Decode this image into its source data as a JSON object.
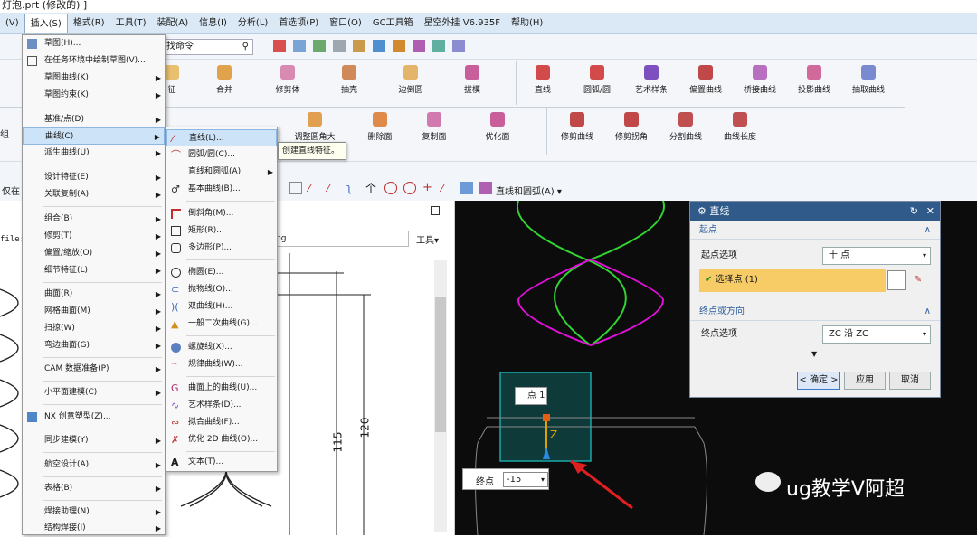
{
  "window": {
    "title": "灯泡.prt  (修改的)  ]"
  },
  "menubar": [
    "(V)",
    "插入(S)",
    "格式(R)",
    "工具(T)",
    "装配(A)",
    "信息(I)",
    "分析(L)",
    "首选项(P)",
    "窗口(O)",
    "GC工具箱",
    "星空外挂 V6.935F",
    "帮助(H)"
  ],
  "toolbar": {
    "search_placeholder": "找命令",
    "line_arc_label": "直线和圆弧(A) ▾"
  },
  "ribbon": {
    "row1": [
      "征",
      "合并",
      "修剪体",
      "抽壳",
      "边倒圆",
      "拔模",
      "直线",
      "圆弧/圆",
      "艺术样条",
      "偏置曲线",
      "桥接曲线",
      "投影曲线",
      "抽取曲线"
    ],
    "row2": [
      "调整圆角大",
      "删除面",
      "复制面",
      "优化面",
      "修剪曲线",
      "修剪拐角",
      "分割曲线",
      "曲线长度"
    ],
    "left_stub": "组"
  },
  "insert_menu": [
    "草图(H)...",
    "在任务环境中绘制草图(V)...",
    "草图曲线(K)",
    "草图约束(K)",
    "基准/点(D)",
    "曲线(C)",
    "派生曲线(U)",
    "设计特征(E)",
    "关联复制(A)",
    "组合(B)",
    "修剪(T)",
    "偏置/缩放(O)",
    "细节特征(L)",
    "曲面(R)",
    "网格曲面(M)",
    "扫掠(W)",
    "弯边曲面(G)",
    "CAM 数据准备(P)",
    "小平面建模(C)",
    "NX 创意塑型(Z)...",
    "同步建模(Y)",
    "航空设计(A)",
    "表格(B)",
    "焊接助理(N)",
    "结构焊接(I)"
  ],
  "curve_menu": [
    "直线(L)...",
    "圆弧/圆(C)...",
    "直线和圆弧(A)",
    "基本曲线(B)...",
    "倒斜角(M)...",
    "矩形(R)...",
    "多边形(P)...",
    "椭圆(E)...",
    "抛物线(O)...",
    "双曲线(H)...",
    "一般二次曲线(G)...",
    "螺旋线(X)...",
    "规律曲线(W)...",
    "曲面上的曲线(U)...",
    "艺术样条(D)...",
    "拟合曲线(F)...",
    "优化 2D 曲线(O)...",
    "文本(T)..."
  ],
  "tooltip": "创建直线特征。",
  "leftpane": {
    "filter_label": "仅在",
    "file_label": "file:",
    "path_suffix": "pg",
    "tools_label": "工具▾",
    "dim_115": "115",
    "dim_120": "120"
  },
  "dialog": {
    "title": "直线",
    "start_section": "起点",
    "start_option_label": "起点选项",
    "start_option_value": "十 点",
    "select_point": "选择点 (1)",
    "end_section": "终点或方向",
    "end_option_label": "终点选项",
    "end_option_value": "ZC 沿 ZC",
    "ok": "< 确定 >",
    "apply": "应用",
    "cancel": "取消"
  },
  "viewport": {
    "point_label": "点 1",
    "end_label": "终点",
    "end_value": "-15",
    "z_label": "Z",
    "watermark": "ug教学V阿超"
  },
  "colors": {
    "menubar_bg": "#dbe9f6",
    "dialog_header": "#2f5a8a",
    "select_highlight": "#f7cc66",
    "helix_green": "#31d431",
    "helix_magenta": "#e010d8",
    "box_teal": "#1aa7a7"
  }
}
